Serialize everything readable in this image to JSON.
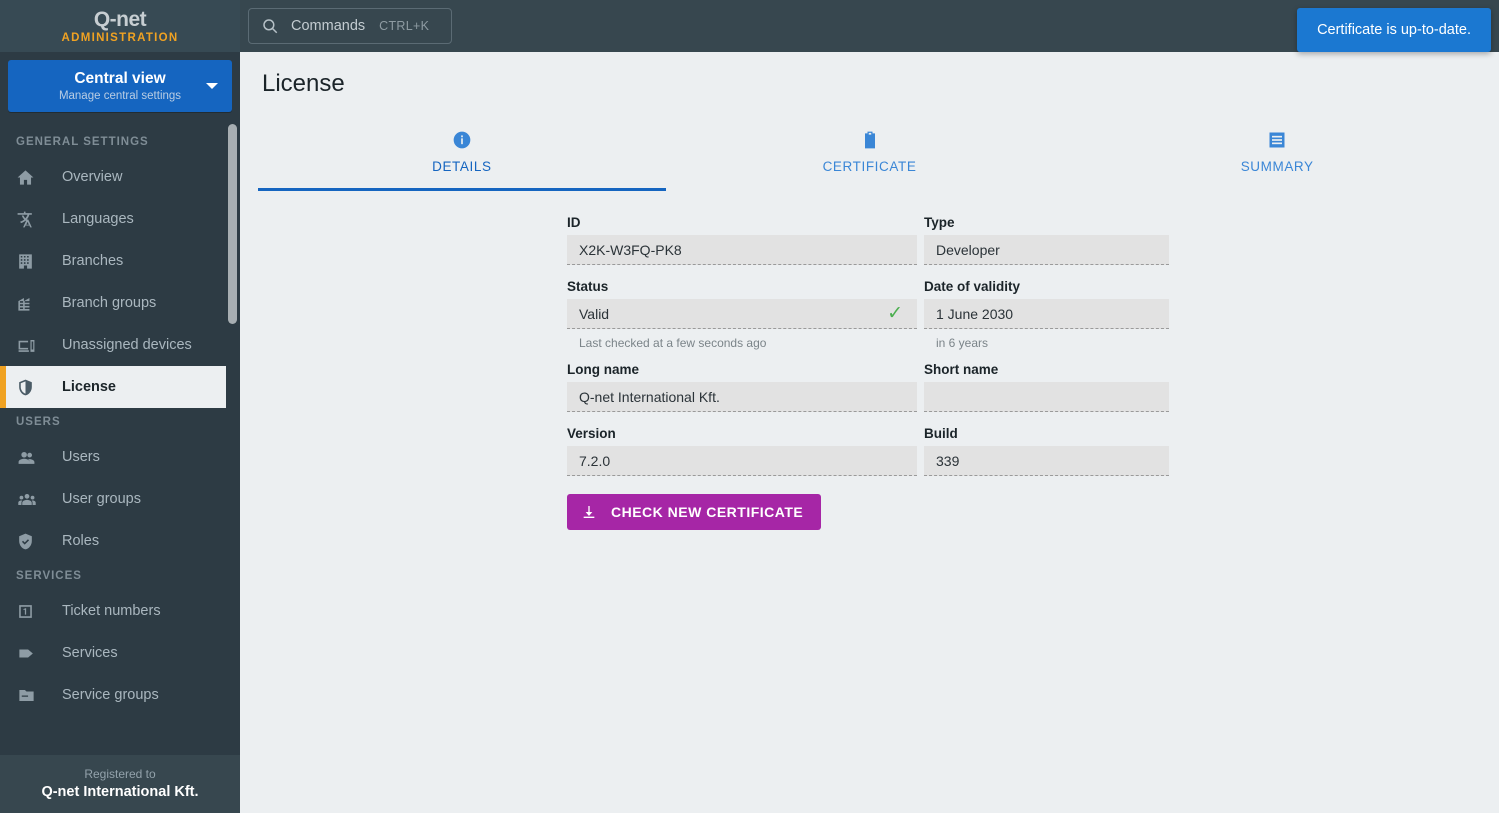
{
  "brand": {
    "logo": "Q-net",
    "subtitle": "ADMINISTRATION"
  },
  "view_selector": {
    "title": "Central view",
    "subtitle": "Manage central settings",
    "caret_icon": "chevron-down-icon"
  },
  "sidebar": {
    "sections": [
      {
        "label": "GENERAL SETTINGS",
        "items": [
          {
            "label": "Overview",
            "icon": "home-icon",
            "active": false
          },
          {
            "label": "Languages",
            "icon": "translate-icon",
            "active": false
          },
          {
            "label": "Branches",
            "icon": "building-icon",
            "active": false
          },
          {
            "label": "Branch groups",
            "icon": "buildings-icon",
            "active": false
          },
          {
            "label": "Unassigned devices",
            "icon": "devices-icon",
            "active": false
          },
          {
            "label": "License",
            "icon": "shield-icon",
            "active": true
          }
        ]
      },
      {
        "label": "USERS",
        "items": [
          {
            "label": "Users",
            "icon": "users-icon",
            "active": false
          },
          {
            "label": "User groups",
            "icon": "user-groups-icon",
            "active": false
          },
          {
            "label": "Roles",
            "icon": "shield-check-icon",
            "active": false
          }
        ]
      },
      {
        "label": "SERVICES",
        "items": [
          {
            "label": "Ticket numbers",
            "icon": "ticket-number-icon",
            "active": false
          },
          {
            "label": "Services",
            "icon": "tag-icon",
            "active": false
          },
          {
            "label": "Service groups",
            "icon": "folder-icon",
            "active": false
          }
        ]
      }
    ]
  },
  "registered": {
    "label": "Registered to",
    "value": "Q-net International Kft."
  },
  "topbar": {
    "command_palette": {
      "icon": "search-icon",
      "label": "Commands",
      "shortcut": "CTRL+K"
    },
    "mail_icon": "envelope-icon"
  },
  "toast": {
    "message": "Certificate is up-to-date.",
    "color": "#1b78d1"
  },
  "page": {
    "title": "License"
  },
  "tabs": [
    {
      "label": "DETAILS",
      "icon": "info-circle-icon",
      "active": true
    },
    {
      "label": "CERTIFICATE",
      "icon": "clipboard-icon",
      "active": false
    },
    {
      "label": "SUMMARY",
      "icon": "list-box-icon",
      "active": false
    }
  ],
  "details": {
    "id": {
      "label": "ID",
      "value": "X2K-W3FQ-PK8"
    },
    "type": {
      "label": "Type",
      "value": "Developer"
    },
    "status": {
      "label": "Status",
      "value": "Valid",
      "status_icon": "check-icon",
      "status_color": "#4caf50",
      "hint": "Last checked at a few seconds ago"
    },
    "date_of_validity": {
      "label": "Date of validity",
      "value": "1 June 2030",
      "hint": "in 6 years"
    },
    "long_name": {
      "label": "Long name",
      "value": "Q-net International Kft."
    },
    "short_name": {
      "label": "Short name",
      "value": ""
    },
    "version": {
      "label": "Version",
      "value": "7.2.0"
    },
    "build": {
      "label": "Build",
      "value": "339"
    },
    "check_button": {
      "label": "CHECK NEW CERTIFICATE",
      "icon": "download-icon",
      "color": "#a626a6"
    }
  }
}
